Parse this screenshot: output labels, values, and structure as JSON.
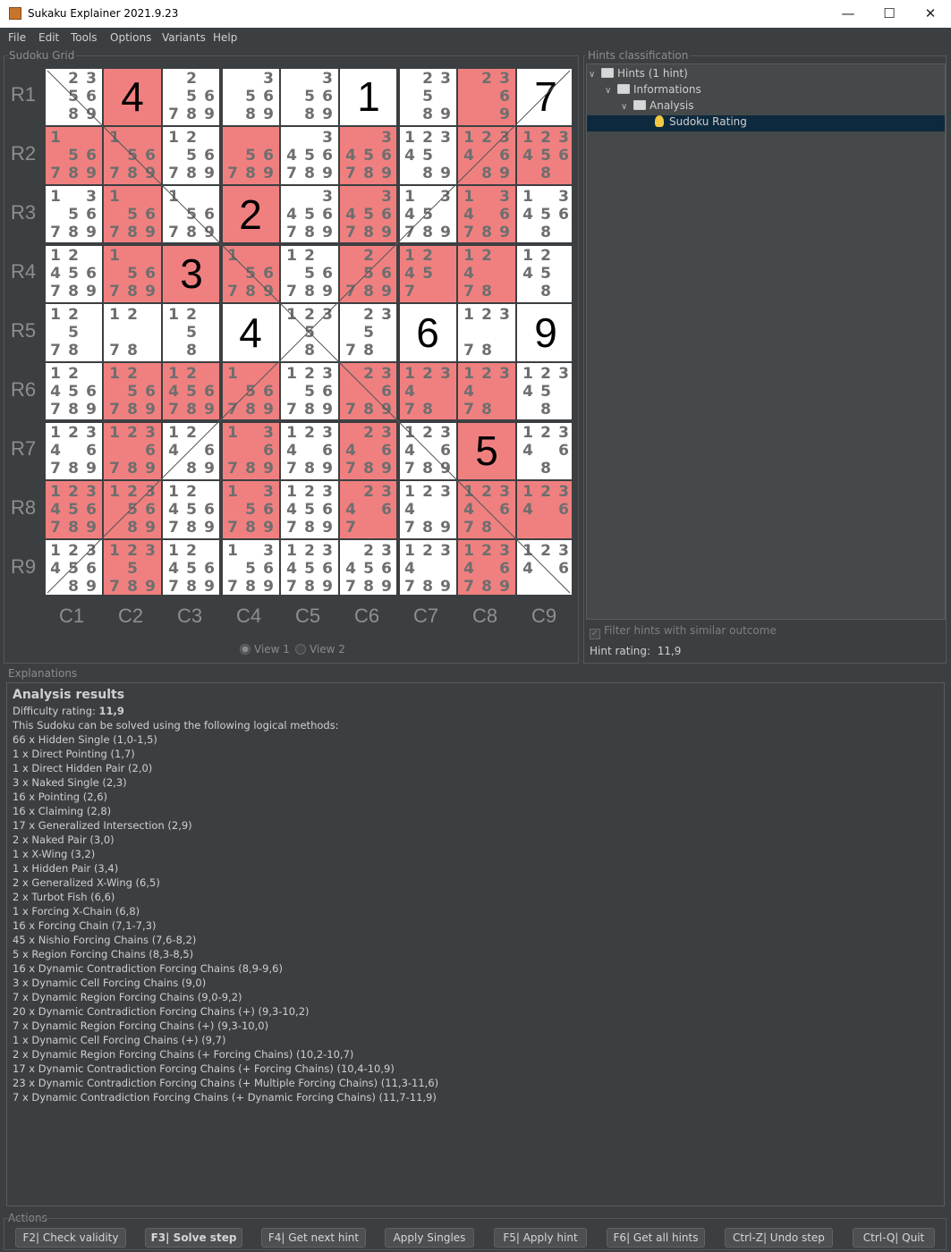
{
  "window": {
    "title": "Sukaku Explainer 2021.9.23",
    "minimize_icon": "minimize-icon",
    "maximize_icon": "maximize-icon",
    "close_icon": "close-icon"
  },
  "menu": [
    "File",
    "Edit",
    "Tools",
    "Options",
    "Variants",
    "Help"
  ],
  "grid_panel": {
    "title": "Sudoku Grid",
    "row_labels": [
      "R1",
      "R2",
      "R3",
      "R4",
      "R5",
      "R6",
      "R7",
      "R8",
      "R9"
    ],
    "col_labels": [
      "C1",
      "C2",
      "C3",
      "C4",
      "C5",
      "C6",
      "C7",
      "C8",
      "C9"
    ],
    "view1_label": "View 1",
    "view2_label": "View 2",
    "selected_view": "View 1"
  },
  "colors": {
    "highlight": "#f08080",
    "cell_bg": "#ffffff",
    "given": "#000000",
    "candidate": "#6e6e6e",
    "selection": "#0d293e"
  },
  "grid": {
    "values": [
      [
        0,
        4,
        0,
        0,
        0,
        1,
        0,
        0,
        7
      ],
      [
        0,
        0,
        0,
        0,
        0,
        0,
        0,
        0,
        0
      ],
      [
        0,
        0,
        0,
        2,
        0,
        0,
        0,
        0,
        0
      ],
      [
        0,
        0,
        3,
        0,
        0,
        0,
        0,
        0,
        0
      ],
      [
        0,
        0,
        0,
        4,
        0,
        0,
        6,
        0,
        9
      ],
      [
        0,
        0,
        0,
        0,
        0,
        0,
        0,
        0,
        0
      ],
      [
        0,
        0,
        0,
        0,
        0,
        0,
        0,
        5,
        0
      ],
      [
        0,
        0,
        0,
        0,
        0,
        0,
        0,
        0,
        0
      ],
      [
        0,
        0,
        0,
        0,
        0,
        0,
        0,
        0,
        0
      ]
    ],
    "candidates": [
      [
        "235689",
        "",
        "256789",
        "35689",
        "35689",
        "",
        "23589",
        "2369",
        ""
      ],
      [
        "156789",
        "156789",
        "1256789",
        "56789",
        "3456789",
        "3456789",
        "1234589",
        "1234689",
        "1234568"
      ],
      [
        "1356789",
        "156789",
        "156789",
        "",
        "3456789",
        "3456789",
        "1345789",
        "1346789",
        "134568"
      ],
      [
        "12456789",
        "156789",
        "",
        "156789",
        "1256789",
        "256789",
        "12457",
        "12478",
        "12458"
      ],
      [
        "12578",
        "1278",
        "1258",
        "",
        "12358",
        "23578",
        "",
        "12378",
        ""
      ],
      [
        "12456789",
        "1256789",
        "12456789",
        "156789",
        "12356789",
        "236789",
        "123478",
        "123478",
        "123458"
      ],
      [
        "12346789",
        "1236789",
        "124689",
        "136789",
        "12346789",
        "2346789",
        "12346789",
        "",
        "123468"
      ],
      [
        "123456789",
        "1235689",
        "12456789",
        "1356789",
        "123456789",
        "23467",
        "1234789",
        "1234678",
        "12346"
      ],
      [
        "12345689",
        "1235789",
        "12456789",
        "1356789",
        "123456789",
        "23456789",
        "1234789",
        "12346789",
        "12346"
      ]
    ],
    "highlighted": [
      [
        0,
        1,
        0,
        0,
        0,
        0,
        0,
        1,
        0
      ],
      [
        1,
        1,
        0,
        1,
        0,
        1,
        0,
        1,
        1
      ],
      [
        0,
        1,
        0,
        1,
        0,
        1,
        0,
        1,
        0
      ],
      [
        0,
        1,
        1,
        1,
        0,
        1,
        1,
        1,
        0
      ],
      [
        0,
        0,
        0,
        0,
        0,
        0,
        0,
        0,
        0
      ],
      [
        0,
        1,
        1,
        1,
        0,
        1,
        1,
        1,
        0
      ],
      [
        0,
        1,
        0,
        1,
        0,
        1,
        0,
        1,
        0
      ],
      [
        1,
        1,
        0,
        1,
        0,
        1,
        0,
        1,
        1
      ],
      [
        0,
        1,
        0,
        0,
        0,
        0,
        0,
        1,
        0
      ]
    ]
  },
  "hints_panel": {
    "title": "Hints classification",
    "tree": [
      {
        "label": "Hints (1 hint)",
        "depth": 0,
        "expanded": true,
        "icon": "folder-icon"
      },
      {
        "label": "Informations",
        "depth": 1,
        "expanded": true,
        "icon": "folder-icon"
      },
      {
        "label": "Analysis",
        "depth": 2,
        "expanded": true,
        "icon": "folder-icon"
      },
      {
        "label": "Sudoku Rating",
        "depth": 3,
        "selected": true,
        "icon": "lightbulb-icon"
      }
    ],
    "filter_label": "Filter hints with similar outcome",
    "filter_checked": true,
    "hint_rating_label": "Hint rating:",
    "hint_rating_value": "11,9"
  },
  "explanations": {
    "title": "Explanations",
    "heading": "Analysis results",
    "difficulty_label": "Difficulty rating:",
    "difficulty_value": "11,9",
    "intro": "This Sudoku can be solved using the following logical methods:",
    "methods": [
      "66 x Hidden Single (1,0-1,5)",
      "1 x Direct Pointing (1,7)",
      "1 x Direct Hidden Pair (2,0)",
      "3 x Naked Single (2,3)",
      "16 x Pointing (2,6)",
      "16 x Claiming (2,8)",
      "17 x Generalized Intersection (2,9)",
      "2 x Naked Pair (3,0)",
      "1 x X-Wing (3,2)",
      "1 x Hidden Pair (3,4)",
      "2 x Generalized X-Wing (6,5)",
      "2 x Turbot Fish (6,6)",
      "1 x Forcing X-Chain (6,8)",
      "16 x Forcing Chain (7,1-7,3)",
      "45 x Nishio Forcing Chains (7,6-8,2)",
      "5 x Region Forcing Chains (8,3-8,5)",
      "16 x Dynamic Contradiction Forcing Chains (8,9-9,6)",
      "3 x Dynamic Cell Forcing Chains (9,0)",
      "7 x Dynamic Region Forcing Chains (9,0-9,2)",
      "20 x Dynamic Contradiction Forcing Chains (+) (9,3-10,2)",
      "7 x Dynamic Region Forcing Chains (+) (9,3-10,0)",
      "1 x Dynamic Cell Forcing Chains (+) (9,7)",
      "2 x Dynamic Region Forcing Chains (+ Forcing Chains) (10,2-10,7)",
      "17 x Dynamic Contradiction Forcing Chains (+ Forcing Chains) (10,4-10,9)",
      "23 x Dynamic Contradiction Forcing Chains (+ Multiple Forcing Chains) (11,3-11,6)",
      "7 x Dynamic Contradiction Forcing Chains (+ Dynamic Forcing Chains) (11,7-11,9)"
    ]
  },
  "actions": {
    "title": "Actions",
    "buttons": [
      {
        "label": "F2| Check validity",
        "bold": false
      },
      {
        "label": "F3| Solve step",
        "bold": true
      },
      {
        "label": "F4| Get next hint",
        "bold": false
      },
      {
        "label": "Apply Singles",
        "bold": false
      },
      {
        "label": "F5| Apply hint",
        "bold": false
      },
      {
        "label": "F6| Get all hints",
        "bold": false
      },
      {
        "label": "Ctrl-Z| Undo step",
        "bold": false
      },
      {
        "label": "Ctrl-Q| Quit",
        "bold": false
      }
    ]
  }
}
